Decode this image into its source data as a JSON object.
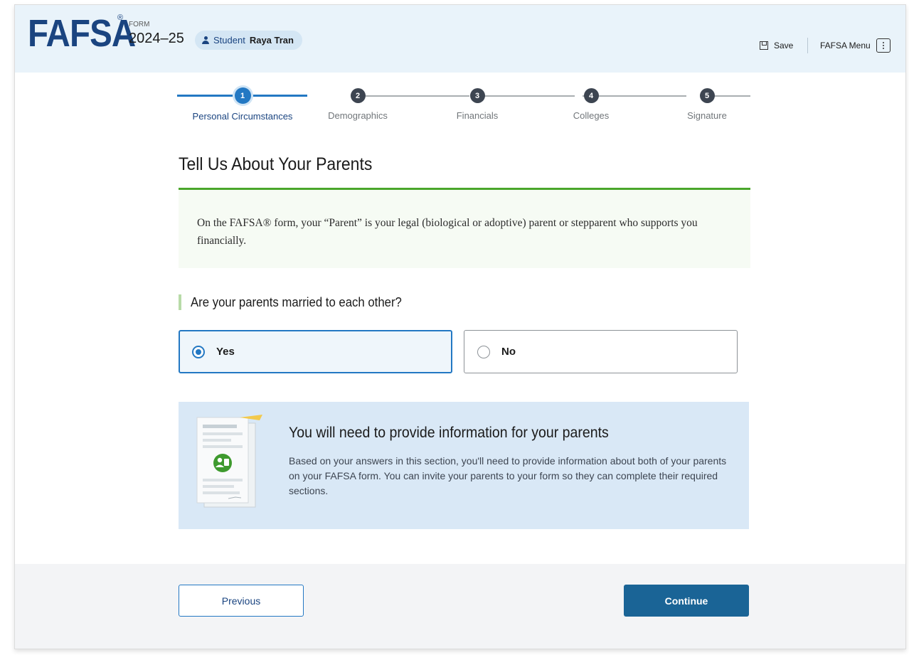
{
  "header": {
    "logo": "FAFSA",
    "logo_mark": "®",
    "form_label": "FORM",
    "form_year": "2024–25",
    "student_word": "Student",
    "student_name": "Raya Tran",
    "save_label": "Save",
    "menu_label": "FAFSA Menu"
  },
  "stepper": {
    "current_step": 1,
    "steps": [
      {
        "number": "1",
        "label": "Personal Circumstances"
      },
      {
        "number": "2",
        "label": "Demographics"
      },
      {
        "number": "3",
        "label": "Financials"
      },
      {
        "number": "4",
        "label": "Colleges"
      },
      {
        "number": "5",
        "label": "Signature"
      }
    ]
  },
  "page": {
    "title": "Tell Us About Your Parents",
    "info_text": "On the FAFSA® form, your “Parent” is your legal (biological or adoptive) parent or stepparent who supports you financially.",
    "question": "Are your parents married to each other?",
    "options": [
      {
        "label": "Yes",
        "selected": true
      },
      {
        "label": "No",
        "selected": false
      }
    ],
    "notice_title": "You will need to provide information for your parents",
    "notice_body": "Based on your answers in this section, you'll need to provide information about both of your parents on your FAFSA form. You can invite your parents to your form so they can complete their required sections."
  },
  "footer": {
    "previous_label": "Previous",
    "continue_label": "Continue"
  },
  "colors": {
    "brand_blue": "#1a4480",
    "accent_blue": "#2378c3",
    "continue_blue": "#1a6496",
    "success_green": "#4aa62b"
  }
}
